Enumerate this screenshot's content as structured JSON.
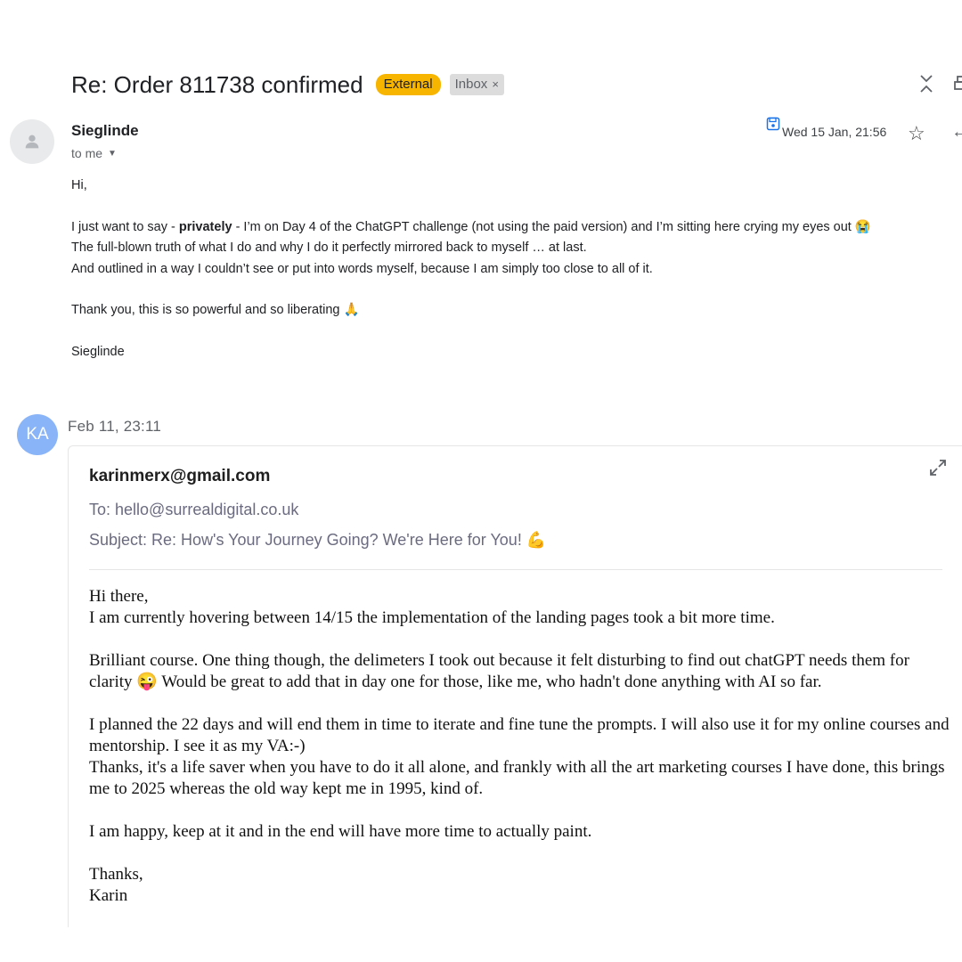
{
  "header": {
    "subject": "Re: Order 811738 confirmed",
    "label_external": "External",
    "label_inbox": "Inbox",
    "label_remove": "×",
    "icons": {
      "collapse": "collapse-all-icon",
      "print": "print-icon"
    }
  },
  "message1": {
    "sender": "Sieglinde",
    "to": "to me",
    "date": "Wed 15 Jan, 21:56",
    "icons": {
      "save": "save-icon",
      "star": "star-icon",
      "reply": "reply-icon"
    },
    "greeting": "Hi,",
    "para1_before": "I just want to say - ",
    "para1_bold": "privately",
    "para1_after": " - I’m on Day 4 of the ChatGPT challenge (not using the paid version) and I’m sitting here crying my eyes out 😭",
    "para1_line2": "The full-blown truth of what I do and why I do it perfectly mirrored back to myself … at last.",
    "para1_line3": "And outlined in a way I couldn’t see or put into words myself, because I am simply too close to all of it.",
    "para2": "Thank you, this is so powerful and so liberating 🙏",
    "signoff": "Sieglinde"
  },
  "message2": {
    "avatar_initials": "KA",
    "date": "Feb 11, 23:11",
    "from": "karinmerx@gmail.com",
    "to": "To: hello@surrealdigital.co.uk",
    "subject": "Subject: Re: How's Your Journey Going? We're Here for You! 💪",
    "body": [
      "Hi there,",
      "I am currently hovering between 14/15 the implementation of the landing pages took a bit more time.",
      "",
      "Brilliant course. One thing though, the delimeters I took out because it felt disturbing to find out chatGPT needs them for clarity 😜 Would be great to add that in day one for those, like me, who hadn't done anything with AI so far.",
      "",
      "I planned the 22 days and will end them in time to iterate and fine tune the prompts. I will also use it for my online courses and mentorship. I see it as my VA:-)",
      "Thanks, it's a life saver when you have to do it all alone, and frankly with all the art marketing courses I have done, this brings me to 2025 whereas the old way kept me in 1995, kind of.",
      "",
      "I am happy, keep at it and in the end will have more time to actually paint.",
      "",
      "Thanks,",
      "Karin"
    ]
  }
}
